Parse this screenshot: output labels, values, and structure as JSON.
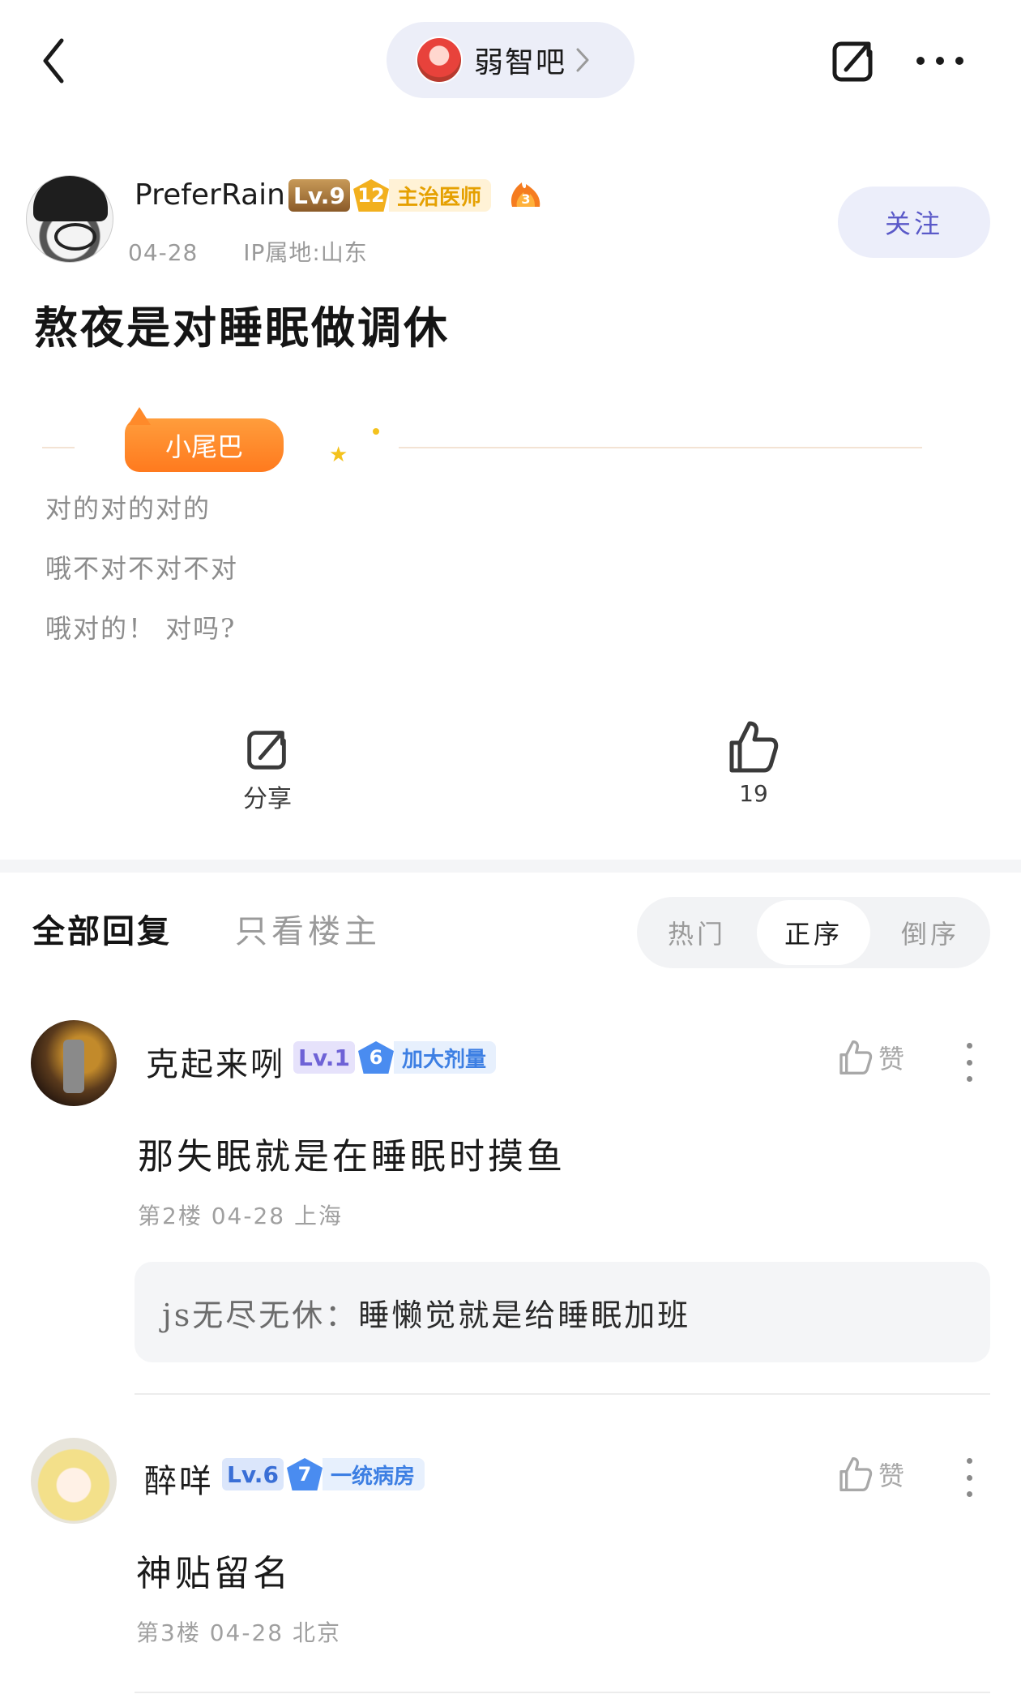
{
  "topbar": {
    "forum_name": "弱智吧"
  },
  "post": {
    "author": {
      "name": "PreferRain",
      "level": "Lv.9",
      "title_num": "12",
      "title_text": "主治医师",
      "fire_num": "3",
      "date": "04-28",
      "ip": "IP属地:山东"
    },
    "follow_label": "关注",
    "title": "熬夜是对睡眠做调休",
    "tail_label": "小尾巴",
    "tail_lines": [
      "对的对的对的",
      "哦不对不对不对",
      "哦对的！ 对吗?"
    ],
    "share_label": "分享",
    "like_count": "19"
  },
  "reply_tabs": {
    "all": "全部回复",
    "owner_only": "只看楼主",
    "sort": [
      "热门",
      "正序",
      "倒序"
    ],
    "selected_sort": "正序"
  },
  "replies": [
    {
      "name": "克起来咧",
      "level": "Lv.1",
      "title_num": "6",
      "title_text": "加大剂量",
      "content": "那失眠就是在睡眠时摸鱼",
      "floor": "第2楼",
      "date": "04-28",
      "location": "上海",
      "like_label": "赞",
      "sub_reply": {
        "user": "js无尽无休：",
        "text": "睡懒觉就是给睡眠加班"
      }
    },
    {
      "name": "醉咩",
      "level": "Lv.6",
      "title_num": "7",
      "title_text": "一统病房",
      "content": "神贴留名",
      "floor": "第3楼",
      "date": "04-28",
      "location": "北京",
      "like_label": "赞"
    }
  ],
  "colors": {
    "accent": "#5a59c8",
    "tail_orange": "#ff8a2a",
    "gold_title": "#e5a000",
    "blue_title": "#3d7fe3"
  }
}
